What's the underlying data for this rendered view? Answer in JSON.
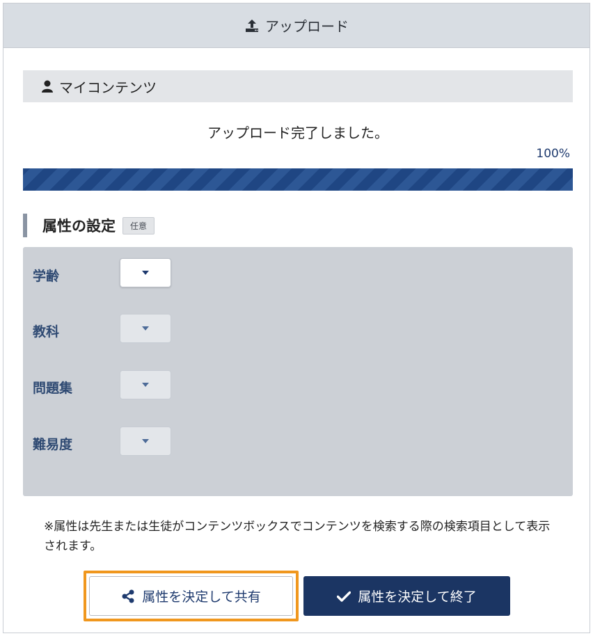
{
  "header": {
    "title": "アップロード",
    "icon": "upload-icon"
  },
  "section": {
    "label": "マイコンテンツ",
    "icon": "user-icon"
  },
  "upload": {
    "message": "アップロード完了しました。",
    "percent_label": "100%",
    "progress": 1.0
  },
  "attributes": {
    "title": "属性の設定",
    "badge": "任意",
    "rows": [
      {
        "label": "学齢",
        "enabled": true
      },
      {
        "label": "教科",
        "enabled": false
      },
      {
        "label": "問題集",
        "enabled": false
      },
      {
        "label": "難易度",
        "enabled": false
      }
    ]
  },
  "note": "※属性は先生または生徒がコンテンツボックスでコンテンツを検索する際の検索項目として表示されます。",
  "buttons": {
    "share_label": "属性を決定して共有",
    "finish_label": "属性を決定して終了"
  },
  "colors": {
    "accent": "#1b3563",
    "highlight": "#f0971e",
    "progress": "#1f4683"
  }
}
